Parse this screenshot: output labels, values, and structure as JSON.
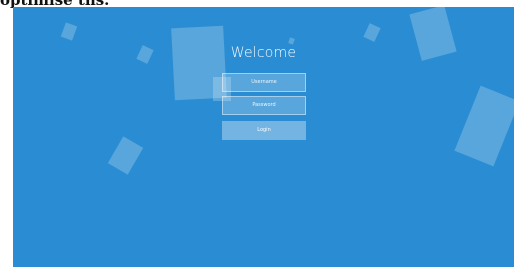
{
  "caption": {
    "text": "optimise ths."
  },
  "login": {
    "title": "Welcome",
    "username_placeholder": "Username",
    "password_placeholder": "Password",
    "button_label": "Login"
  },
  "colors": {
    "background": "#2a8dd3",
    "shape": "rgba(255,255,255,0.22)"
  }
}
